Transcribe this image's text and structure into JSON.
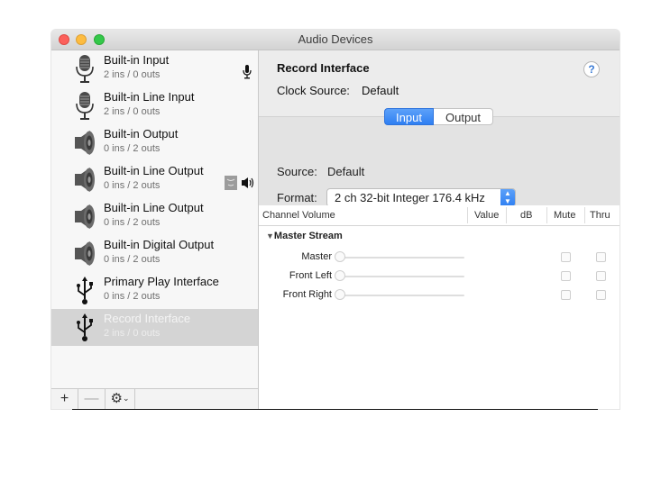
{
  "window": {
    "title": "Audio Devices"
  },
  "sidebar": {
    "devices": [
      {
        "name": "Built-in Input",
        "io": "2 ins / 0 outs",
        "icon": "microphone-icon",
        "badge": "microphone-badge-icon"
      },
      {
        "name": "Built-in Line Input",
        "io": "2 ins / 0 outs",
        "icon": "microphone-icon"
      },
      {
        "name": "Built-in Output",
        "io": "0 ins / 2 outs",
        "icon": "speaker-icon"
      },
      {
        "name": "Built-in Line Output",
        "io": "0 ins / 2 outs",
        "icon": "speaker-icon",
        "badge": "finder-speaker-badge-icon"
      },
      {
        "name": "Built-in Line Output",
        "io": "0 ins / 2 outs",
        "icon": "speaker-icon"
      },
      {
        "name": "Built-in Digital Output",
        "io": "0 ins / 2 outs",
        "icon": "speaker-icon"
      },
      {
        "name": "Primary Play Interface",
        "io": "0 ins / 2 outs",
        "icon": "usb-icon"
      },
      {
        "name": "Record Interface",
        "io": "2 ins / 0 outs",
        "icon": "usb-icon",
        "selected": true
      }
    ],
    "footer": {
      "add": "+",
      "remove": "—",
      "gear": "⚙"
    }
  },
  "detail": {
    "title": "Record Interface",
    "help": "?",
    "clock_source_label": "Clock Source:",
    "clock_source_value": "Default",
    "tabs": [
      {
        "label": "Input",
        "active": true
      },
      {
        "label": "Output",
        "active": false
      }
    ],
    "source_label": "Source:",
    "source_value": "Default",
    "format_label": "Format:",
    "format_value": "2 ch 32-bit Integer 176.4 kHz",
    "table": {
      "columns": [
        "Channel Volume",
        "Value",
        "dB",
        "Mute",
        "Thru"
      ],
      "group": "Master Stream",
      "channels": [
        "Master",
        "Front Left",
        "Front Right"
      ]
    }
  },
  "colors": {
    "accent": "#2f7ff2",
    "selected_row": "#d4d4d4"
  }
}
